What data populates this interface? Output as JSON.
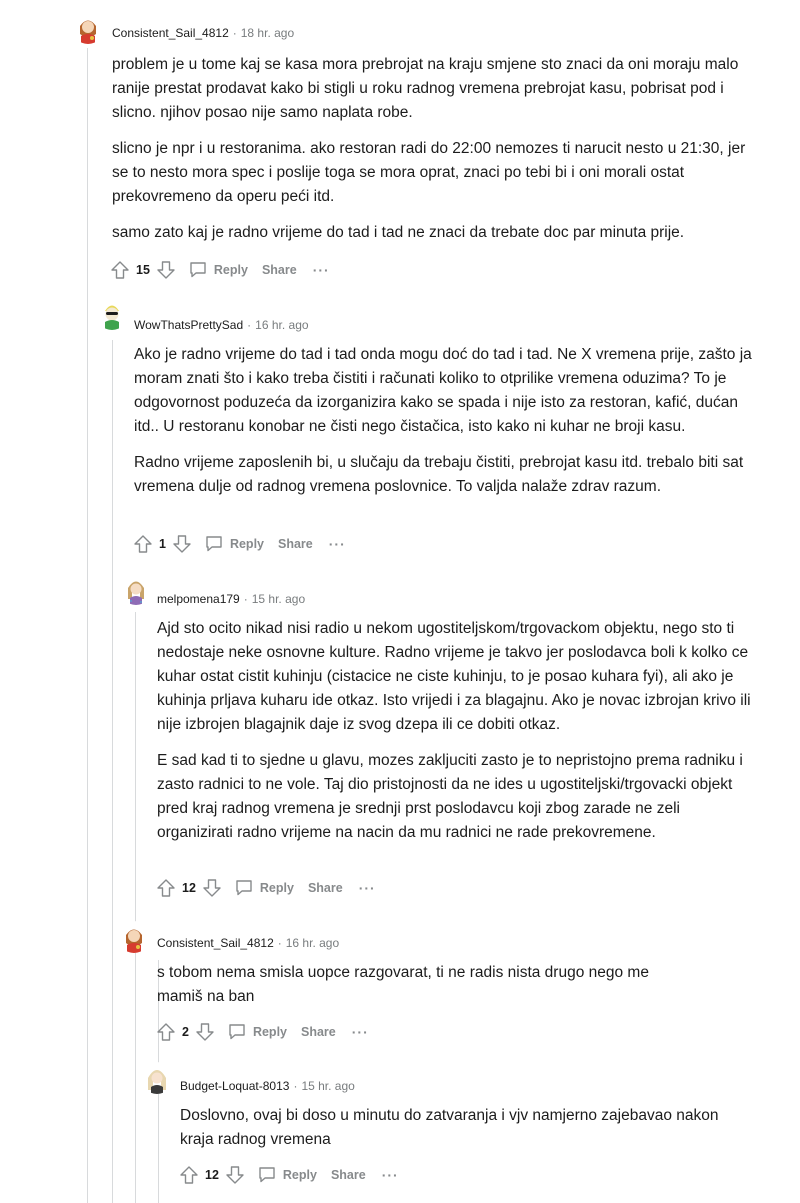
{
  "comments": [
    {
      "user": "Consistent_Sail_4812",
      "time": "18 hr. ago",
      "paragraphs": [
        "problem je u tome kaj se kasa mora prebrojat na kraju smjene sto znaci da oni moraju malo ranije prestat prodavat kako bi stigli u roku radnog vremena prebrojat kasu, pobrisat pod i slicno. njihov posao nije samo naplata robe.",
        "slicno je npr i u restoranima. ako restoran radi do 22:00 nemozes ti narucit nesto u 21:30, jer se to nesto mora spec i poslije toga se mora oprat, znaci po tebi bi i oni morali ostat prekovremeno da operu peći itd.",
        "samo zato kaj je radno vrijeme do tad i tad ne znaci da trebate doc par minuta prije."
      ],
      "votes": "15"
    },
    {
      "user": "WowThatsPrettySad",
      "time": "16 hr. ago",
      "paragraphs": [
        "Ako je radno vrijeme do tad i tad onda mogu doć do tad i tad. Ne X vremena prije, zašto ja moram znati što i kako treba čistiti i računati koliko to otprilike vremena oduzima? To je odgovornost poduzeća da izorganizira kako se spada i nije isto za restoran, kafić, dućan itd.. U restoranu konobar ne čisti nego čistačica, isto kako ni kuhar ne broji kasu.",
        "Radno vrijeme zaposlenih bi, u slučaju da trebaju čistiti, prebrojat kasu itd. trebalo biti sat vremena dulje od radnog vremena poslovnice. To valjda nalaže zdrav razum."
      ],
      "votes": "1"
    },
    {
      "user": "melpomena179",
      "time": "15 hr. ago",
      "paragraphs": [
        "Ajd sto ocito nikad nisi radio u nekom ugostiteljskom/trgovackom objektu, nego sto ti nedostaje neke osnovne kulture. Radno vrijeme je takvo jer poslodavca boli k kolko ce kuhar ostat cistit kuhinju (cistacice ne ciste kuhinju, to je posao kuhara fyi), ali ako je kuhinja prljava kuharu ide otkaz. Isto vrijedi i za blagajnu. Ako je novac izbrojan krivo ili nije izbrojen blagajnik daje iz svog dzepa ili ce dobiti otkaz.",
        "E sad kad ti to sjedne u glavu, mozes zakljuciti zasto je to nepristojno prema radniku i zasto radnici to ne vole. Taj dio pristojnosti da ne ides u ugostiteljski/trgovacki objekt pred kraj radnog vremena je srednji prst poslodavcu koji zbog zarade ne zeli organizirati radno vrijeme na nacin da mu radnici ne rade prekovremene."
      ],
      "votes": "12"
    },
    {
      "user": "Consistent_Sail_4812",
      "time": "16 hr. ago",
      "paragraphs": [
        "s tobom nema smisla uopce razgovarat, ti ne radis nista drugo nego me mamiš na ban"
      ],
      "votes": "2"
    },
    {
      "user": "Budget-Loquat-8013",
      "time": "15 hr. ago",
      "paragraphs": [
        "Doslovno, ovaj bi doso u minutu do zatvaranja i vjv namjerno zajebavao nakon kraja radnog vremena"
      ],
      "votes": "12"
    }
  ],
  "labels": {
    "reply": "Reply",
    "share": "Share",
    "more": "···"
  },
  "icons": {
    "upvote": "upvote-icon",
    "downvote": "downvote-icon",
    "reply": "reply-icon",
    "more": "more-options-icon"
  },
  "colors": {
    "meta": "#787c7e",
    "action": "#878a8c",
    "thread_line": "#d8dadc"
  }
}
